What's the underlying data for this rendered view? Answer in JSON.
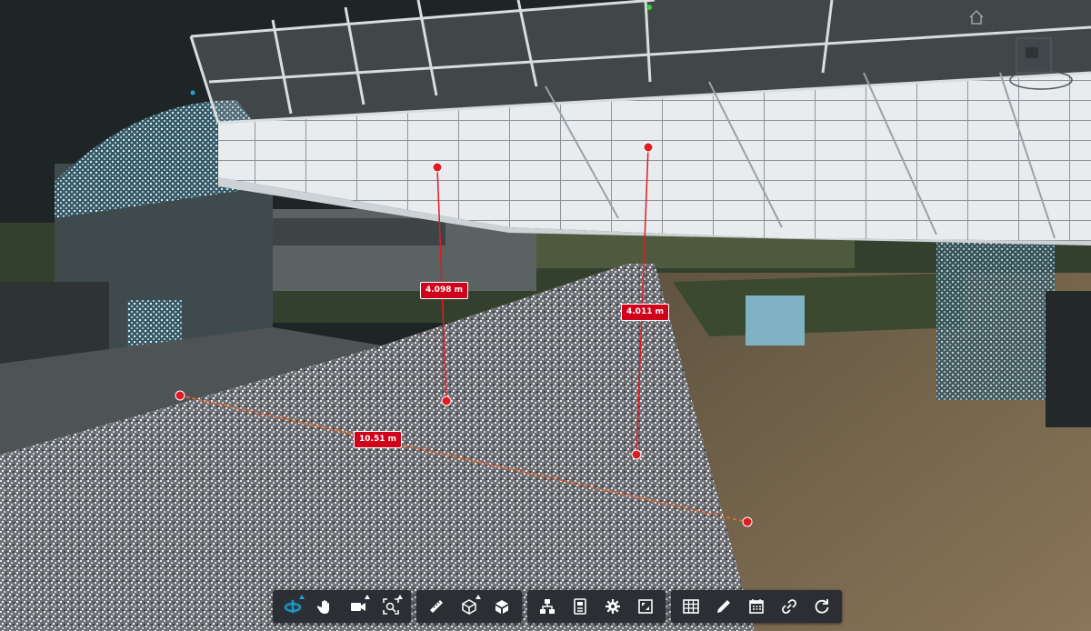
{
  "viewer": {
    "measurements": [
      {
        "name": "vertical-left",
        "value": "4.098 m"
      },
      {
        "name": "vertical-right",
        "value": "4.011 m"
      },
      {
        "name": "horizontal-ground",
        "value": "10.51 m"
      }
    ]
  },
  "colors": {
    "marker": "#e11b22",
    "label_bg": "#d0021b",
    "toolbar_bg": "#2b2f33",
    "accent": "#19a3d9",
    "sky": "#1e2526"
  },
  "toolbar": {
    "groups": [
      {
        "name": "navigation",
        "tools": [
          "orbit-icon",
          "pan-icon",
          "camera-icon",
          "fit-view-icon"
        ]
      },
      {
        "name": "measure",
        "tools": [
          "ruler-icon",
          "section-box-icon",
          "explode-icon"
        ]
      },
      {
        "name": "model",
        "tools": [
          "model-browser-icon",
          "properties-icon",
          "settings-icon",
          "fullscreen-icon"
        ]
      },
      {
        "name": "data",
        "tools": [
          "table-icon",
          "markup-pen-icon",
          "calendar-icon",
          "link-icon",
          "reset-icon"
        ]
      }
    ]
  }
}
